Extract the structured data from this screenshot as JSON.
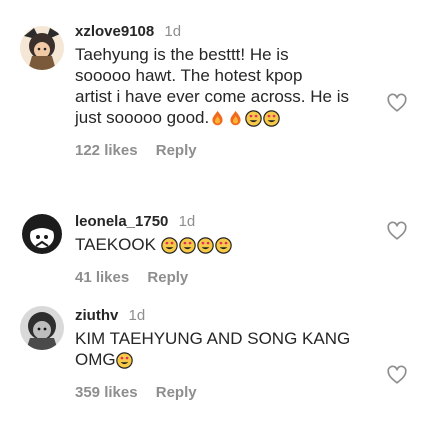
{
  "comments": [
    {
      "username": "xzlove9108",
      "time": "1d",
      "text_lines": [
        "Taehyung is the besttt! He is",
        "sooooo hawt. The hotest kpop",
        "artist i have ever come across. He is",
        "just sooooo good."
      ],
      "emojis": [
        "fire-emoji",
        "fire-emoji",
        "heart-eyes-emoji",
        "heart-eyes-emoji"
      ],
      "likes": "122 likes",
      "reply": "Reply",
      "avatar_icon": "anime-character-avatar"
    },
    {
      "username": "leonela_1750",
      "time": "1d",
      "text_lines": [
        "TAEKOOK"
      ],
      "emojis": [
        "heart-eyes-emoji",
        "heart-eyes-emoji",
        "heart-eyes-emoji",
        "heart-eyes-emoji"
      ],
      "likes": "41 likes",
      "reply": "Reply",
      "avatar_icon": "black-white-character-avatar"
    },
    {
      "username": "ziuthv",
      "time": "1d",
      "text_lines": [
        "KIM TAEHYUNG AND SONG KANG",
        "OMG"
      ],
      "emojis": [
        "heart-eyes-emoji"
      ],
      "likes": "359 likes",
      "reply": "Reply",
      "avatar_icon": "grayscale-character-avatar"
    }
  ],
  "colors": {
    "text": "#262626",
    "muted": "#8e8e8e",
    "emoji_face": "#f7c948",
    "fire_outer": "#f26b1d",
    "fire_inner": "#fbb33a"
  }
}
